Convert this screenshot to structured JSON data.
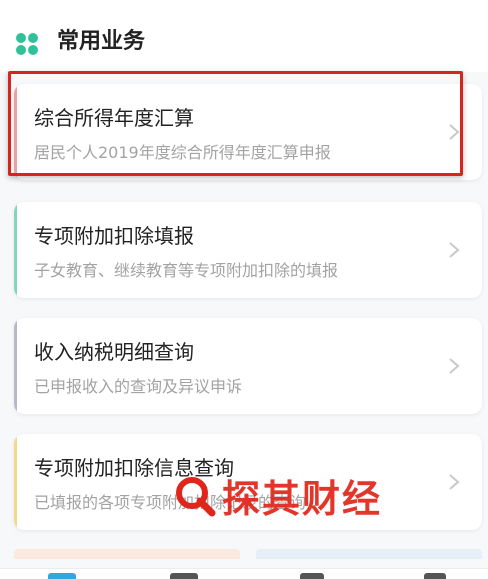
{
  "section": {
    "title": "常用业务",
    "icon": "clover-icon",
    "icon_color": "#2fc29a"
  },
  "cards": [
    {
      "title": "综合所得年度汇算",
      "subtitle": "居民个人2019年度综合所得年度汇算申报",
      "accent": "#e8a0a0"
    },
    {
      "title": "专项附加扣除填报",
      "subtitle": "子女教育、继续教育等专项附加扣除的填报",
      "accent": "#7fd8b8"
    },
    {
      "title": "收入纳税明细查询",
      "subtitle": "已申报收入的查询及异议申诉",
      "accent": "#b8b8c8"
    },
    {
      "title": "专项附加扣除信息查询",
      "subtitle": "已填报的各项专项附加扣除记录的查询",
      "accent": "#f2d98a"
    }
  ],
  "highlight_color": "#d4251f",
  "watermark": {
    "text": "探其财经",
    "color": "#e0251a"
  }
}
